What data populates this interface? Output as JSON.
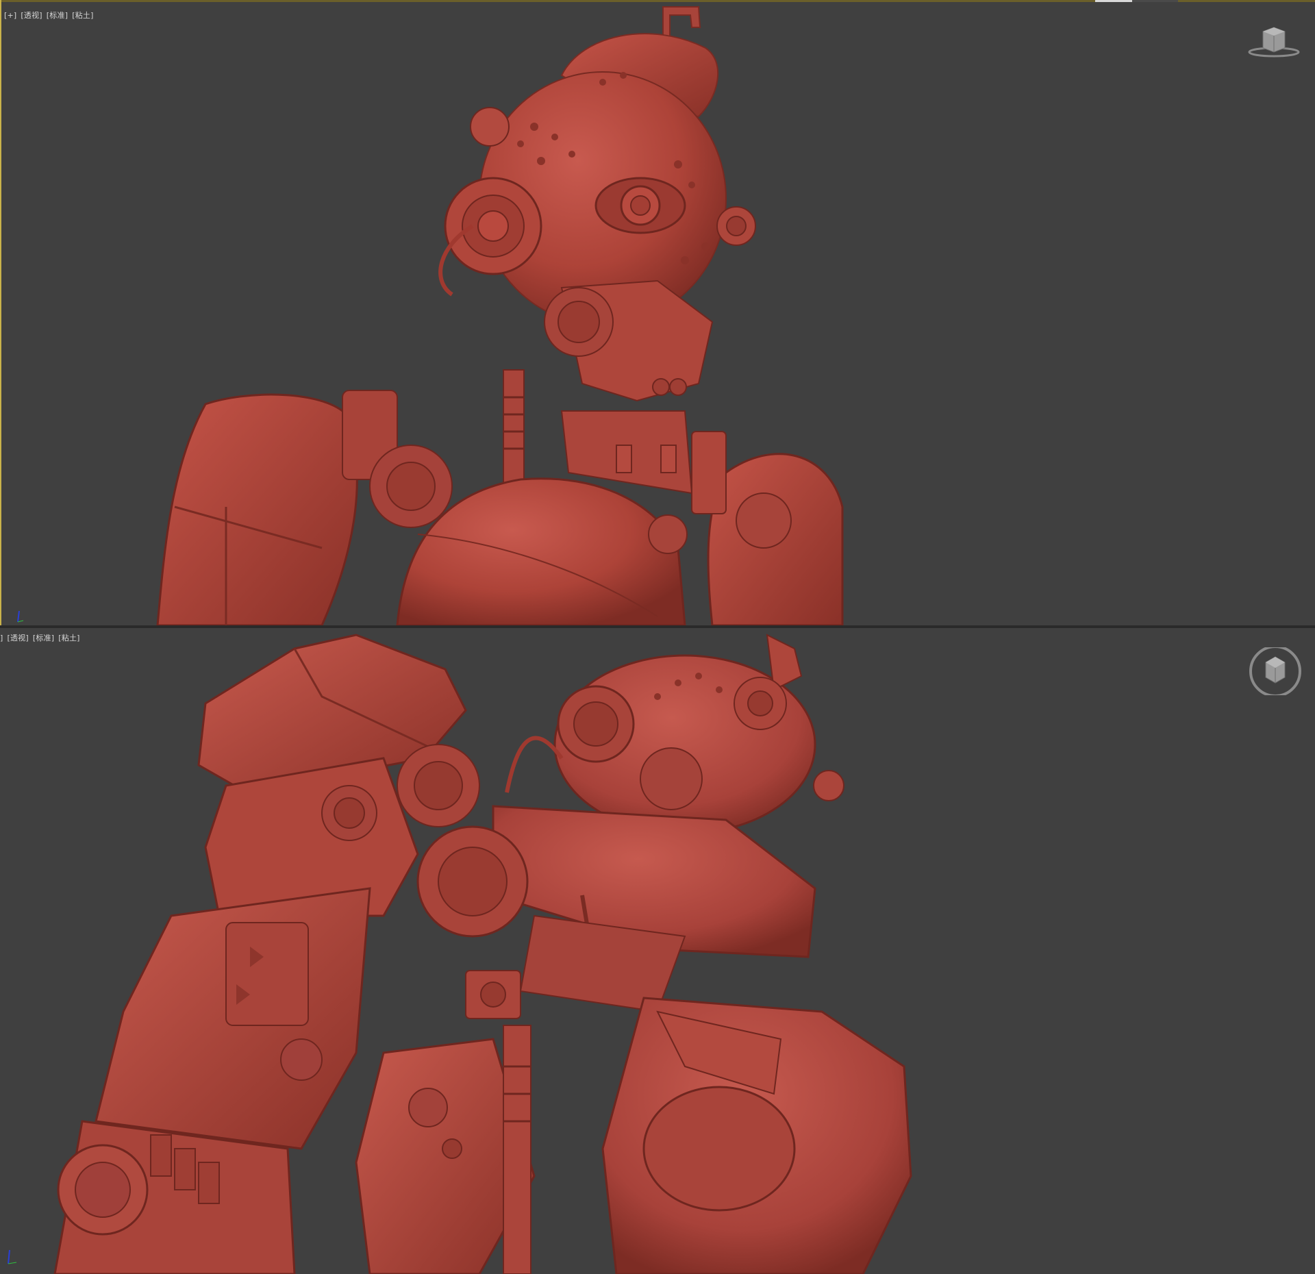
{
  "viewports": [
    {
      "labels": [
        "[+]",
        "[透视]",
        "[标准]",
        "[粘土]"
      ],
      "active": true,
      "material_color": "#b5483d",
      "background_color": "#404040",
      "accent_color": "#c9b24a",
      "render_progress": 0.45
    },
    {
      "labels": [
        "]",
        "[透视]",
        "[标准]",
        "[粘土]"
      ],
      "active": false,
      "material_color": "#b5483d",
      "background_color": "#404040"
    }
  ],
  "icons": {
    "viewcube_top": "viewcube-icon",
    "viewcube_bottom": "viewcube-icon",
    "axis_top": "axis-tripod-icon",
    "axis_bottom": "axis-tripod-icon"
  }
}
